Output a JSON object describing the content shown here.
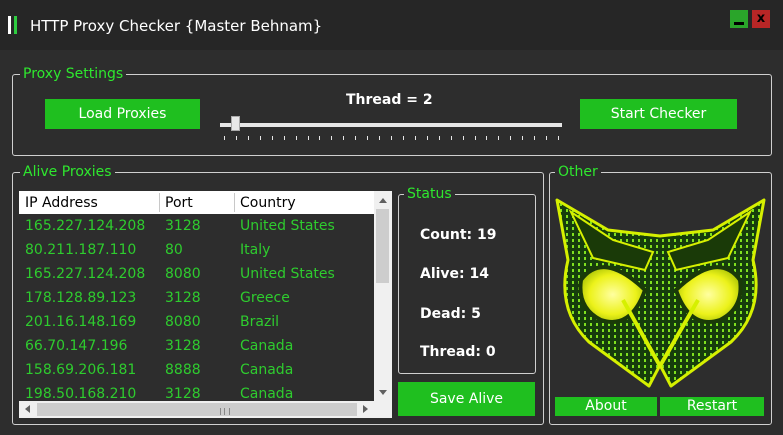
{
  "window": {
    "title": "HTTP Proxy Checker {Master Behnam}",
    "minimize_label": "_",
    "close_label": "x"
  },
  "proxy_settings": {
    "title": "Proxy Settings",
    "load_label": "Load  Proxies",
    "thread_label": "Thread = 2",
    "start_label": "Start Checker",
    "thread_value": 2
  },
  "alive_proxies": {
    "title": "Alive Proxies",
    "columns": [
      "IP Address",
      "Port",
      "Country"
    ],
    "rows": [
      [
        "165.227.124.208",
        "3128",
        "United States"
      ],
      [
        "80.211.187.110",
        "80",
        "Italy"
      ],
      [
        "165.227.124.208",
        "8080",
        "United States"
      ],
      [
        "178.128.89.123",
        "3128",
        "Greece"
      ],
      [
        "201.16.148.169",
        "8080",
        "Brazil"
      ],
      [
        "66.70.147.196",
        "3128",
        "Canada"
      ],
      [
        "158.69.206.181",
        "8888",
        "Canada"
      ],
      [
        "198.50.168.210",
        "3128",
        "Canada"
      ]
    ]
  },
  "status": {
    "title": "Status",
    "count_label": "Count:",
    "count_value": "19",
    "alive_label": "Alive:",
    "alive_value": "14",
    "dead_label": "Dead:",
    "dead_value": "5",
    "thread_label": "Thread:",
    "thread_value": "0"
  },
  "save_label": "Save Alive",
  "other": {
    "title": "Other",
    "about_label": "About",
    "restart_label": "Restart"
  },
  "colors": {
    "accent": "#1fbf1f",
    "text_green": "#2ecc2e",
    "title_green": "#2ee82e",
    "background": "#2d2d2d"
  },
  "icons": [
    "app-icon",
    "minimize-icon",
    "close-icon",
    "owl-logo"
  ]
}
